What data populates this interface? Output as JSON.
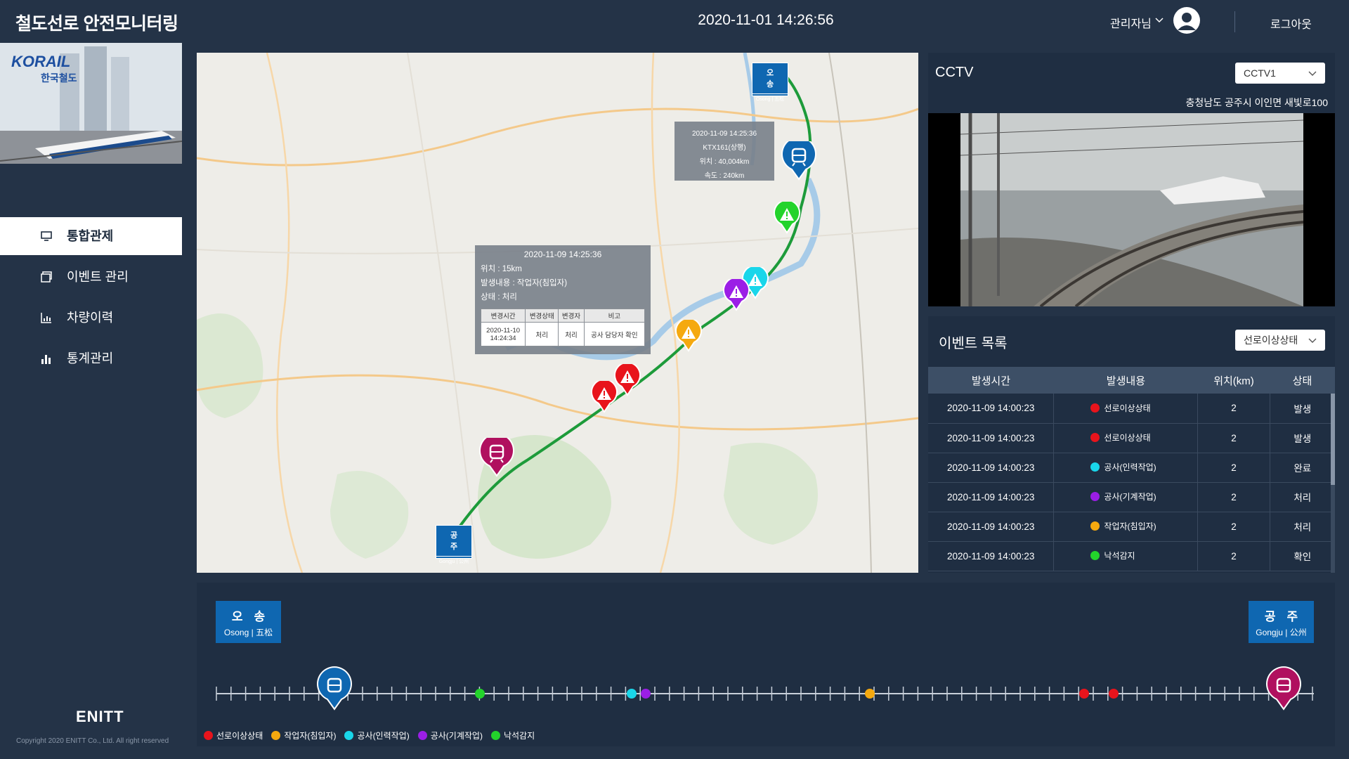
{
  "header": {
    "app_title": "철도선로 안전모니터링",
    "datetime": "2020-11-01  14:26:56",
    "user_name": "관리자님",
    "logout": "로그아웃"
  },
  "sidebar": {
    "logo_text": "KORAIL",
    "logo_sub": "한국철도",
    "items": [
      {
        "label": "통합관제",
        "icon": "monitor-icon",
        "active": true
      },
      {
        "label": "이벤트 관리",
        "icon": "window-icon",
        "active": false
      },
      {
        "label": "차량이력",
        "icon": "line-chart-icon",
        "active": false
      },
      {
        "label": "통계관리",
        "icon": "bar-chart-icon",
        "active": false
      }
    ],
    "brand": "ENITT",
    "copyright": "Copyright 2020 ENITT Co., Ltd. All right reserved"
  },
  "map": {
    "station_osong": {
      "kr": "오송",
      "en": "Osong | 五松"
    },
    "station_gongju": {
      "kr": "공주",
      "en": "Gongju | 公州"
    },
    "train_tip": {
      "time": "2020-11-09  14:25:36",
      "train": "KTX161(상행)",
      "position": "위치 : 40,004km",
      "speed": "속도 : 240km"
    },
    "event_tip": {
      "time": "2020-11-09  14:25:36",
      "position": "위치 : 15km",
      "content": "발생내용 : 작업자(침입자)",
      "status": "상태 : 처리",
      "headers": [
        "변경시간",
        "변경상태",
        "변경자",
        "비고"
      ],
      "row": {
        "time_date": "2020-11-10",
        "time_clock": "14:24:34",
        "state": "처리",
        "changer": "처리",
        "note": "공사 담당자 확인"
      }
    }
  },
  "cctv": {
    "title": "CCTV",
    "selected": "CCTV1",
    "address": "충청남도 공주시 이인면 새빛로100"
  },
  "events": {
    "title": "이벤트 목록",
    "filter": "선로이상상태",
    "columns": [
      "발생시간",
      "발생내용",
      "위치(km)",
      "상태"
    ],
    "rows": [
      {
        "time": "2020-11-09  14:00:23",
        "content": "선로이상상태",
        "color": "#e8141c",
        "pos": "2",
        "status": "발생"
      },
      {
        "time": "2020-11-09  14:00:23",
        "content": "선로이상상태",
        "color": "#e8141c",
        "pos": "2",
        "status": "발생"
      },
      {
        "time": "2020-11-09  14:00:23",
        "content": "공사(인력작업)",
        "color": "#19d6ea",
        "pos": "2",
        "status": "완료"
      },
      {
        "time": "2020-11-09  14:00:23",
        "content": "공사(기계작업)",
        "color": "#9b1ee6",
        "pos": "2",
        "status": "처리"
      },
      {
        "time": "2020-11-09  14:00:23",
        "content": "작업자(침입자)",
        "color": "#f5a90f",
        "pos": "2",
        "status": "처리"
      },
      {
        "time": "2020-11-09  14:00:23",
        "content": "낙석감지",
        "color": "#23d32b",
        "pos": "2",
        "status": "확인"
      }
    ]
  },
  "timeline": {
    "start": {
      "kr": "오송",
      "en": "Osong | 五松"
    },
    "end": {
      "kr": "공주",
      "en": "Gongju | 公州"
    },
    "legend": [
      {
        "label": "선로이상상태",
        "color": "#e8141c"
      },
      {
        "label": "작업자(침입자)",
        "color": "#f5a90f"
      },
      {
        "label": "공사(인력작업)",
        "color": "#19d6ea"
      },
      {
        "label": "공사(기계작업)",
        "color": "#9b1ee6"
      },
      {
        "label": "낙석감지",
        "color": "#23d32b"
      }
    ]
  }
}
